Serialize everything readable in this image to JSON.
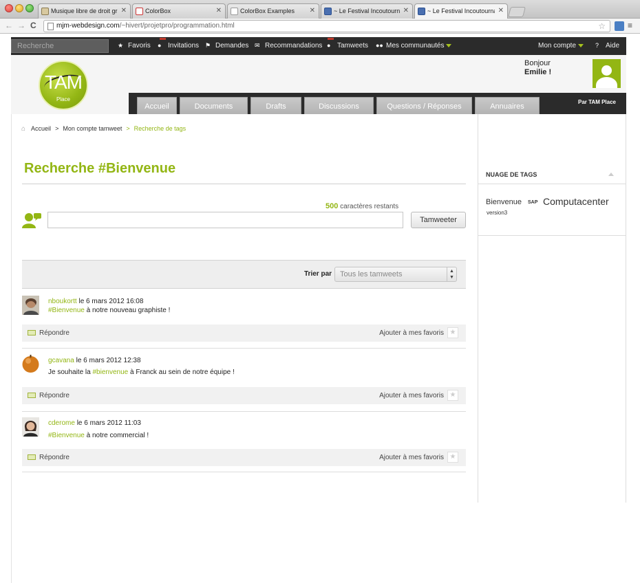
{
  "browser": {
    "tabs": [
      {
        "label": "Musique libre de droit gratu",
        "active": false
      },
      {
        "label": "ColorBox",
        "active": false
      },
      {
        "label": "ColorBox Examples",
        "active": false
      },
      {
        "label": "~ Le Festival Incoutournable",
        "active": false
      },
      {
        "label": "~ Le Festival Incoutournable",
        "active": true
      }
    ],
    "url_host": "mjm-webdesign.com",
    "url_path": "/~hivert/projetpro/programmation.html"
  },
  "topbar": {
    "search_placeholder": "Recherche",
    "items": [
      {
        "label": "Favoris",
        "icon": "star-icon"
      },
      {
        "label": "Invitations",
        "icon": "user-add-icon"
      },
      {
        "label": "Demandes",
        "icon": "flag-icon"
      },
      {
        "label": "Recommandations",
        "icon": "mail-icon"
      },
      {
        "label": "Tamweets",
        "icon": "user-icon"
      },
      {
        "label": "Mes communautés",
        "icon": "group-icon"
      }
    ],
    "account": "Mon compte",
    "help": "Aide"
  },
  "header": {
    "logo_text": "TAM",
    "logo_sub": "Place",
    "greeting": "Bonjour",
    "username": "Emilie !",
    "tabs": [
      "Accueil",
      "Documents",
      "Drafts",
      "Discussions",
      "Questions / Réponses",
      "Annuaires"
    ],
    "brand": "Par TAM Place"
  },
  "breadcrumb": {
    "home": "Accueil",
    "items": [
      "Mon compte tamweet",
      "Recherche de tags"
    ]
  },
  "page": {
    "title": "Recherche #Bienvenue",
    "chars_count": "500",
    "chars_label": "caractères restants",
    "compose_value": "",
    "submit_label": "Tamweeter",
    "sort_label": "Trier par",
    "sort_value": "Tous les tamweets"
  },
  "posts": [
    {
      "user": "nboukortt",
      "date": "le 6 mars 2012 16:08",
      "tag": "#Bienvenue",
      "before": "",
      "after": " à notre nouveau graphiste !",
      "reply": "Répondre",
      "fav": "Ajouter à mes favoris"
    },
    {
      "user": "gcavana",
      "date": "le 6 mars 2012 12:38",
      "tag": "#bienvenue",
      "before": "Je souhaite la ",
      "after": " à Franck au sein de notre équipe !",
      "reply": "Répondre",
      "fav": "Ajouter à mes favoris"
    },
    {
      "user": "cderome",
      "date": "le 6 mars 2012 11:03",
      "tag": "#Bienvenue",
      "before": "",
      "after": " à notre commercial !",
      "reply": "Répondre",
      "fav": "Ajouter à mes favoris"
    }
  ],
  "tag_cloud": {
    "title": "NUAGE DE TAGS",
    "tags": [
      "Bienvenue",
      "SAP",
      "Computacenter",
      "version3"
    ]
  },
  "colors": {
    "accent": "#93b614",
    "dark": "#2b2b2b"
  }
}
